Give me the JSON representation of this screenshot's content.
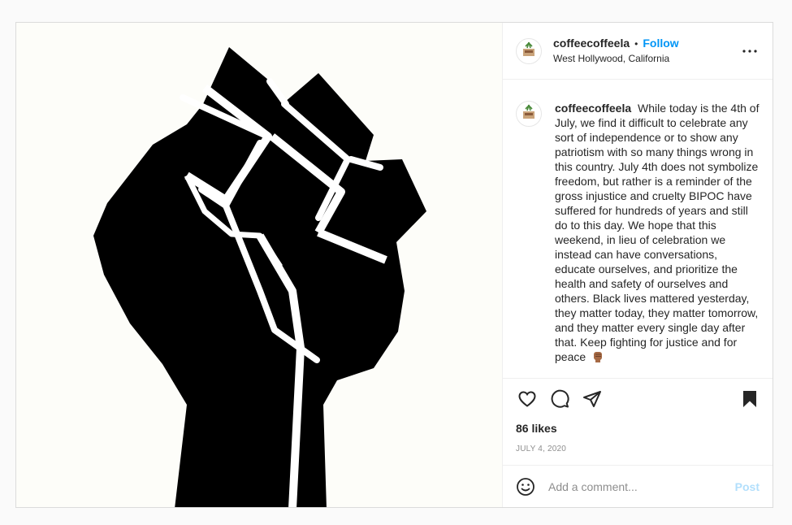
{
  "post": {
    "username": "coffeecoffeela",
    "dot": "•",
    "follow_label": "Follow",
    "location": "West Hollywood, California",
    "more_icon": "more-horizontal-icon",
    "image_alt": "raised-fist-image",
    "caption_text": "While today is the 4th of July, we find it difficult to celebrate any sort of independence or to show any patriotism with so many things wrong in this country. July 4th does not symbolize freedom, but rather is a reminder of the gross injustice and cruelty BIPOC have suffered for hundreds of years and still do to this day. We hope that this weekend, in lieu of celebration we instead can have conversations, educate ourselves, and prioritize the health and safety of ourselves and others. Black lives mattered yesterday, they matter today, they matter tomorrow, and they matter every single day after that. Keep fighting for justice and for peace",
    "caption_emoji": "raised-fist-emoji",
    "likes": "86 likes",
    "date": "JULY 4, 2020"
  },
  "actions": {
    "like_icon": "heart-icon",
    "comment_icon": "comment-icon",
    "share_icon": "share-icon",
    "save_icon": "bookmark-icon"
  },
  "comment": {
    "emoji_icon": "smiley-icon",
    "placeholder": "Add a comment...",
    "post_label": "Post"
  },
  "colors": {
    "link_blue": "#0095f6",
    "post_disabled": "#b2dffc",
    "text": "#262626",
    "muted": "#8e8e8e"
  }
}
